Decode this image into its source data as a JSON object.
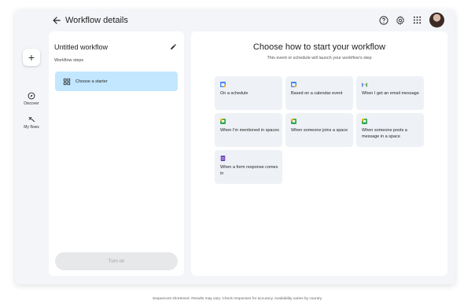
{
  "header": {
    "title": "Workflow details"
  },
  "rail": {
    "add_label": "+",
    "items": [
      {
        "label": "Discover",
        "icon": "compass-icon"
      },
      {
        "label": "My flows",
        "icon": "flows-icon"
      }
    ]
  },
  "left_panel": {
    "workflow_name": "Untitled workflow",
    "steps_label": "Workflow steps",
    "starter_label": "Choose a starter",
    "turn_on_label": "Turn on"
  },
  "main": {
    "title": "Choose how to start your workflow",
    "subtitle": "This event or schedule will launch your workflow's step",
    "cards": [
      {
        "label": "On a schedule",
        "icon": "calendar-icon"
      },
      {
        "label": "Based on a calendar event",
        "icon": "calendar-icon"
      },
      {
        "label": "When I get an email message",
        "icon": "gmail-icon"
      },
      {
        "label": "When I'm mentioned in spaces",
        "icon": "chat-icon"
      },
      {
        "label": "When someone joins a space",
        "icon": "chat-icon"
      },
      {
        "label": "When someone posts a message in a space",
        "icon": "chat-icon"
      },
      {
        "label": "When a form response comes in",
        "icon": "forms-icon"
      }
    ]
  },
  "footer": {
    "text": "Sequences shortened. Results may vary. Check responses for accuracy. Availability varies by country."
  },
  "colors": {
    "accent": "#c2e7ff",
    "canvas": "#f3f5f8",
    "card": "#eef2f6",
    "button_disabled": "#e7e8ea"
  }
}
